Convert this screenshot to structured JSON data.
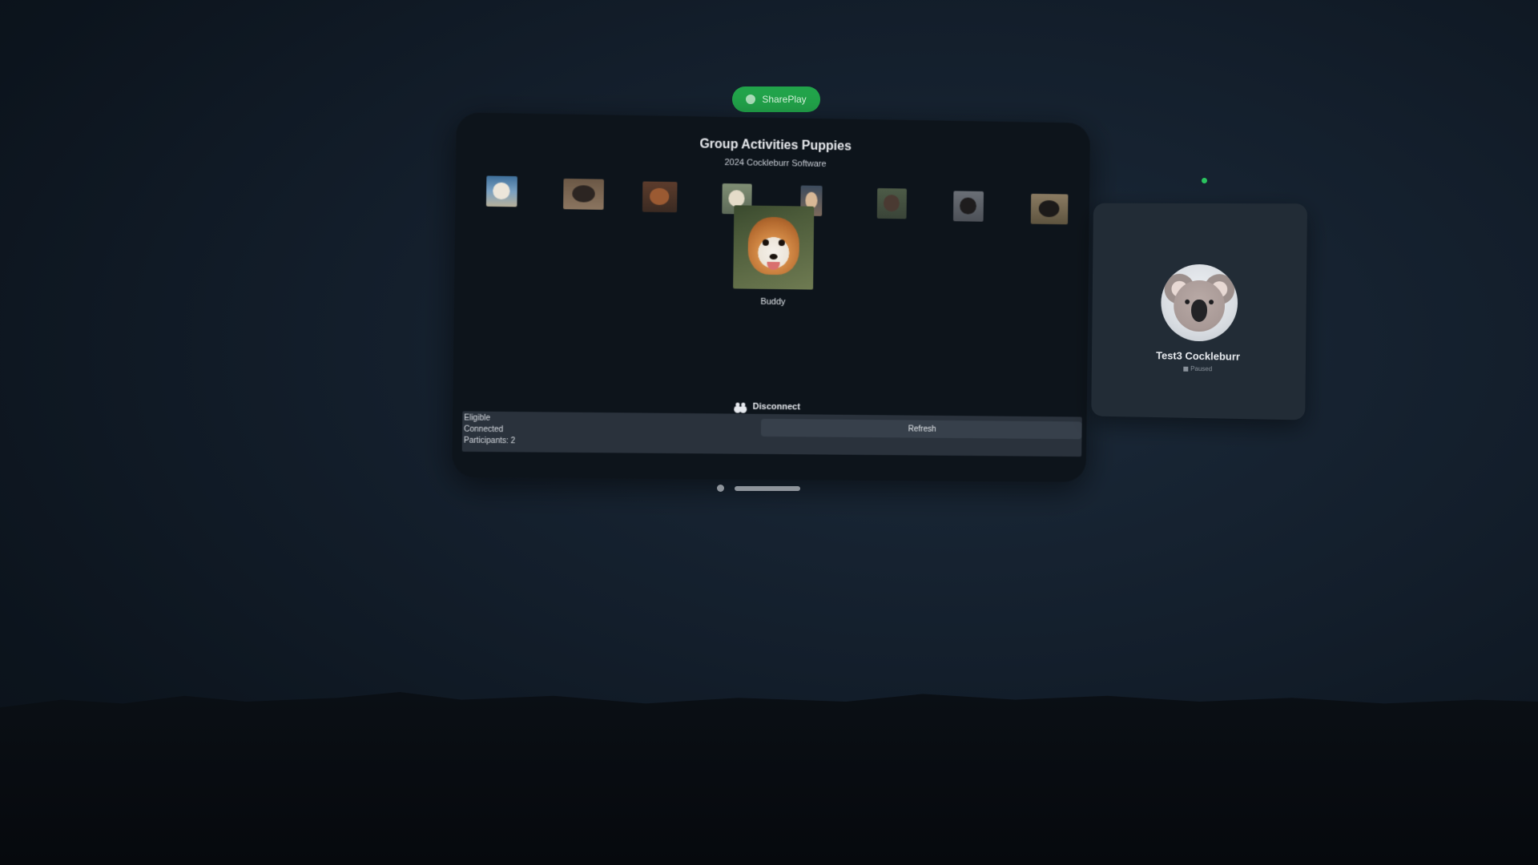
{
  "shareplay": {
    "label": "SharePlay",
    "color": "#21a44a"
  },
  "app": {
    "title": "Group Activities Puppies",
    "subtitle": "2024 Cockleburr Software",
    "featured_name": "Buddy",
    "disconnect_label": "Disconnect",
    "status": {
      "eligible": "Eligible",
      "connected": "Connected",
      "participants": "Participants: 2"
    },
    "refresh_label": "Refresh"
  },
  "participant": {
    "name": "Test3 Cockleburr",
    "status": "Paused",
    "avatar_icon": "koala-memoji-icon"
  },
  "indicator_color": "#2ac35e"
}
